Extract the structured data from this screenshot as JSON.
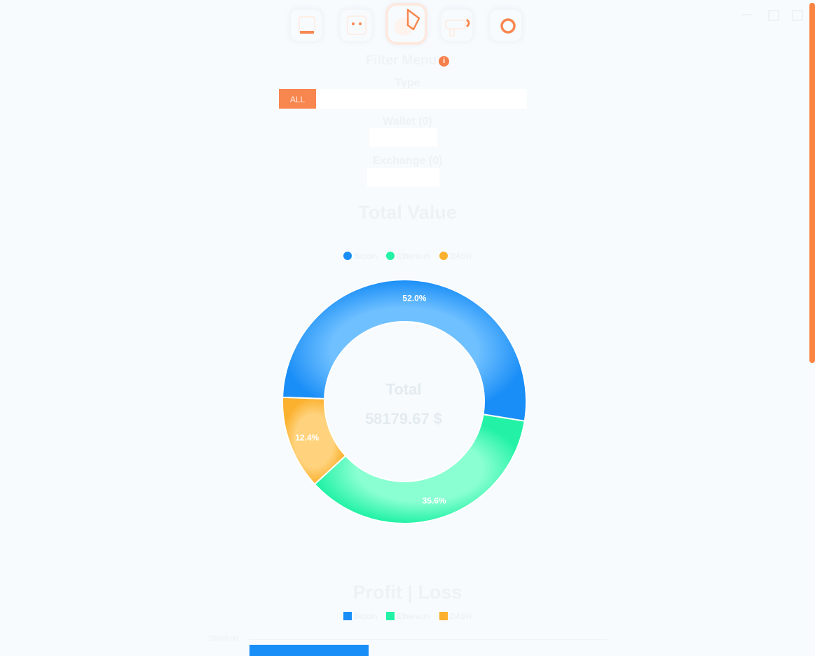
{
  "nav": {
    "items": [
      {
        "name": "wallet-nav-icon",
        "active": false
      },
      {
        "name": "dashboard-nav-icon",
        "active": false
      },
      {
        "name": "pie-chart-nav-icon",
        "active": true
      },
      {
        "name": "transfer-nav-icon",
        "active": false
      },
      {
        "name": "settings-nav-icon",
        "active": false
      }
    ]
  },
  "filter": {
    "title": "Filter Menu",
    "info": "i",
    "type_label": "Type",
    "all_label": "ALL",
    "wallet_label": "Wallet (0)",
    "exchange_label": "Exchange (0)"
  },
  "donut": {
    "title": "Total Value",
    "center_label": "Total",
    "center_value": "58179.67 $"
  },
  "profit": {
    "title": "Profit | Loss",
    "tick_label": "20000.00"
  },
  "colors": {
    "accent": "#f8864f",
    "bitcoin": "#1a8ef7",
    "ethereum": "#23f2a6",
    "other": "#fbb12e"
  },
  "chart_data": [
    {
      "type": "pie",
      "title": "Total Value",
      "series": [
        {
          "name": "Bitcoin",
          "value": 52.0,
          "label": "52.0%"
        },
        {
          "name": "Ethereum",
          "value": 35.6,
          "label": "35.6%"
        },
        {
          "name": "DASH",
          "value": 12.4,
          "label": "12.4%"
        }
      ],
      "legend": "top"
    },
    {
      "type": "bar",
      "title": "Profit | Loss",
      "series": [
        {
          "name": "Bitcoin"
        },
        {
          "name": "Ethereum"
        },
        {
          "name": "DASH"
        }
      ],
      "ytick": "20000.00",
      "legend": "top"
    }
  ]
}
